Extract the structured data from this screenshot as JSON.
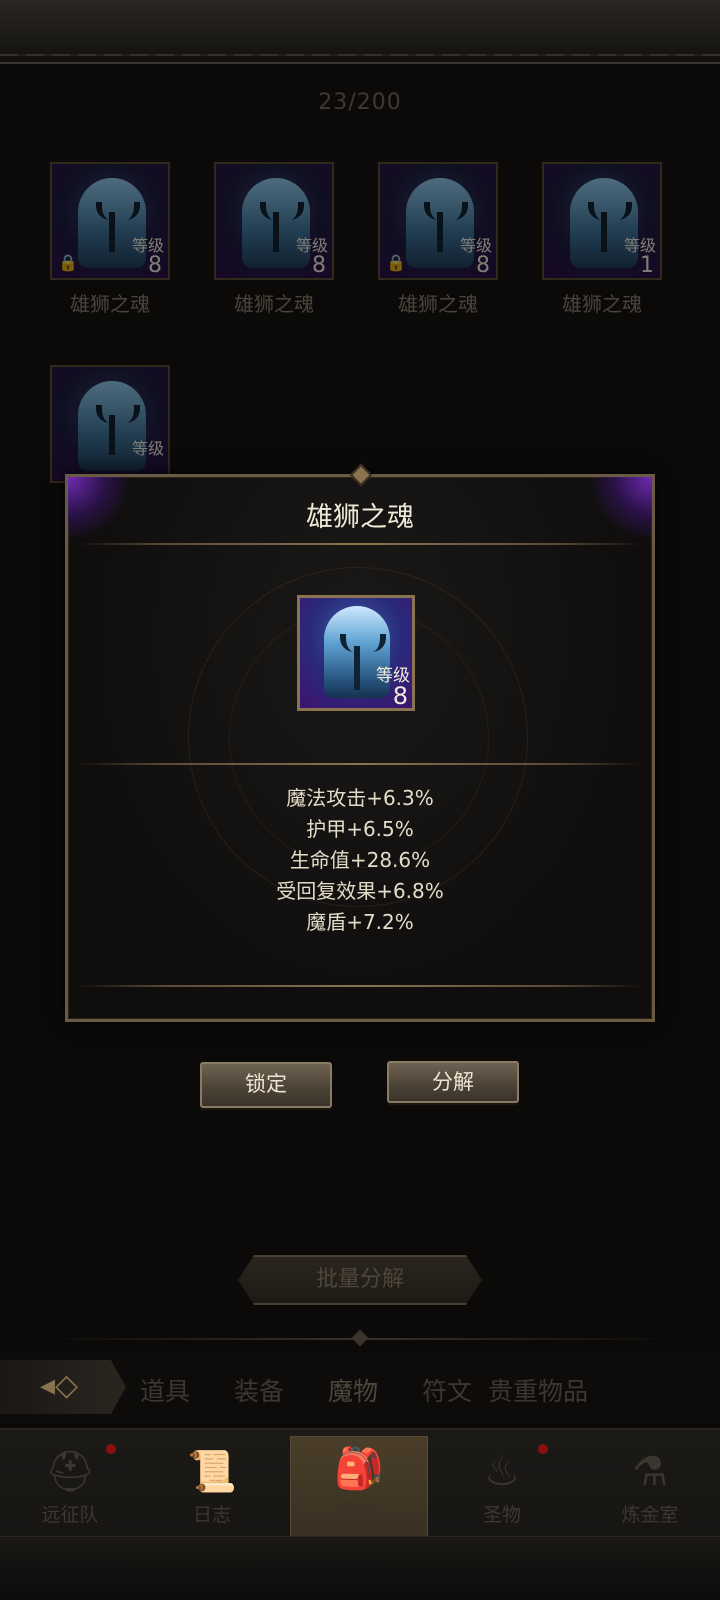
{
  "inventory": {
    "capacity": "23/200",
    "items": [
      {
        "name": "雄狮之魂",
        "level_label": "等级",
        "level": "8",
        "locked": true
      },
      {
        "name": "雄狮之魂",
        "level_label": "等级",
        "level": "8",
        "locked": false
      },
      {
        "name": "雄狮之魂",
        "level_label": "等级",
        "level": "8",
        "locked": true
      },
      {
        "name": "雄狮之魂",
        "level_label": "等级",
        "level": "1",
        "locked": false
      },
      {
        "name": "",
        "level_label": "等级",
        "level": "",
        "locked": false
      }
    ]
  },
  "detail": {
    "title": "雄狮之魂",
    "level_label": "等级",
    "level": "8",
    "stats": [
      "魔法攻击+6.3%",
      "护甲+6.5%",
      "生命值+28.6%",
      "受回复效果+6.8%",
      "魔盾+7.2%"
    ]
  },
  "actions": {
    "lock_label": "锁定",
    "decompose_label": "分解",
    "batch_decompose_label": "批量分解"
  },
  "tabs": [
    "道具",
    "装备",
    "魔物",
    "符文",
    "贵重物品"
  ],
  "active_tab": "魔物",
  "nav": {
    "items": [
      {
        "label": "远征队",
        "icon": "helmet-icon",
        "badge": true
      },
      {
        "label": "日志",
        "icon": "scroll-icon",
        "badge": false
      },
      {
        "label": "背包",
        "icon": "bag-icon",
        "badge": false,
        "active": true
      },
      {
        "label": "圣物",
        "icon": "torch-icon",
        "badge": true
      },
      {
        "label": "炼金室",
        "icon": "alchemy-icon",
        "badge": false
      }
    ]
  },
  "colors": {
    "accent_gold": "#8a7450",
    "rarity_purple": "#6f2bb3",
    "badge_red": "#8a1010"
  }
}
